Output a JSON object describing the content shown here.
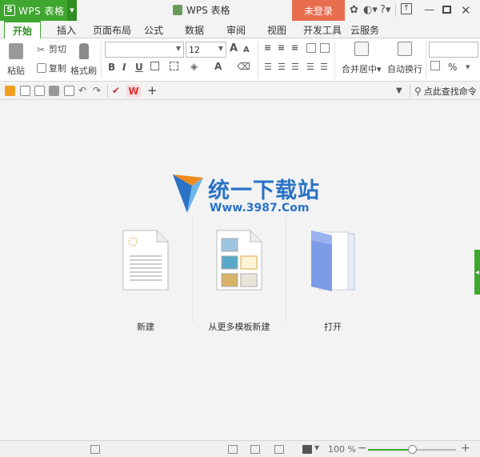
{
  "titlebar": {
    "app_name": "WPS 表格",
    "app_logo": "S",
    "document_title": "WPS 表格",
    "login_label": "未登录",
    "icons": [
      "skin-icon",
      "theme-icon",
      "help-icon",
      "upload-icon",
      "minimize-icon",
      "maximize-icon",
      "close-icon"
    ]
  },
  "tabs": [
    "开始",
    "插入",
    "页面布局",
    "公式",
    "数据",
    "审阅",
    "视图",
    "开发工具",
    "云服务"
  ],
  "ribbon": {
    "paste_label": "粘贴",
    "cut_label": "剪切",
    "copy_label": "复制",
    "format_painter_label": "格式刷",
    "font_name": "",
    "font_size": "12",
    "bold": "B",
    "italic": "I",
    "underline": "U",
    "grow_font": "A",
    "shrink_font": "A",
    "font_color": "A",
    "merge_label": "合并居中",
    "wrap_label": "自动换行",
    "percent": "%"
  },
  "quickbar": {
    "add": "+",
    "search_label": "点此查找命令"
  },
  "start_page": {
    "brand_title": "统一下载站",
    "brand_url": "Www.3987.Com",
    "actions": [
      {
        "label": "新建",
        "icon": "new-doc-icon"
      },
      {
        "label": "从更多模板新建",
        "icon": "template-icon"
      },
      {
        "label": "打开",
        "icon": "open-folder-icon"
      }
    ]
  },
  "statusbar": {
    "zoom": "100 %",
    "zoom_minus": "−",
    "zoom_plus": "+",
    "zoom_fraction": 0.5
  },
  "colors": {
    "brand_green": "#3fa62f",
    "login_orange": "#e86d4f",
    "brand_blue": "#2a73c6",
    "brand_orange": "#f08a1c"
  }
}
